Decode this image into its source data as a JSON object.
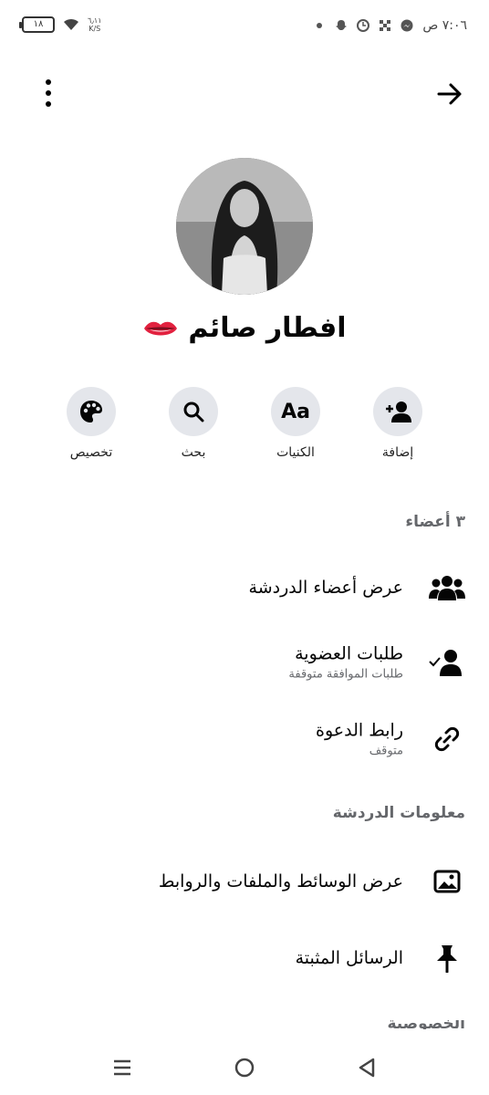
{
  "status_bar": {
    "time": "٧:٠٦ ص",
    "battery": "١٨",
    "speed_value": "٦٫١١",
    "speed_unit": "K/S"
  },
  "header": {
    "back_icon": "arrow-right-icon",
    "menu_icon": "more-vertical-icon"
  },
  "profile": {
    "name": "افطار صائم",
    "emoji_icon": "lips-icon"
  },
  "actions": [
    {
      "label": "إضافة",
      "icon": "add-person-icon"
    },
    {
      "label": "الكنيات",
      "icon_text": "Aa"
    },
    {
      "label": "بحث",
      "icon": "search-icon"
    },
    {
      "label": "تخصيص",
      "icon": "palette-icon"
    }
  ],
  "members_section": {
    "title": "٣ أعضاء",
    "items": [
      {
        "label": "عرض أعضاء الدردشة",
        "icon": "group-icon"
      },
      {
        "label": "طلبات العضوية",
        "sublabel": "طلبات الموافقة متوقفة",
        "icon": "person-check-icon"
      },
      {
        "label": "رابط الدعوة",
        "sublabel": "متوقف",
        "icon": "link-icon"
      }
    ]
  },
  "chat_info_section": {
    "title": "معلومات الدردشة",
    "items": [
      {
        "label": "عرض الوسائط والملفات والروابط",
        "icon": "image-icon"
      },
      {
        "label": "الرسائل المثبتة",
        "icon": "pin-icon"
      }
    ]
  },
  "cut_section_title": "الخصوصية",
  "nav_bar": {
    "menu_icon": "recent-apps-icon",
    "home_icon": "home-circle-icon",
    "back_icon": "back-triangle-icon"
  }
}
